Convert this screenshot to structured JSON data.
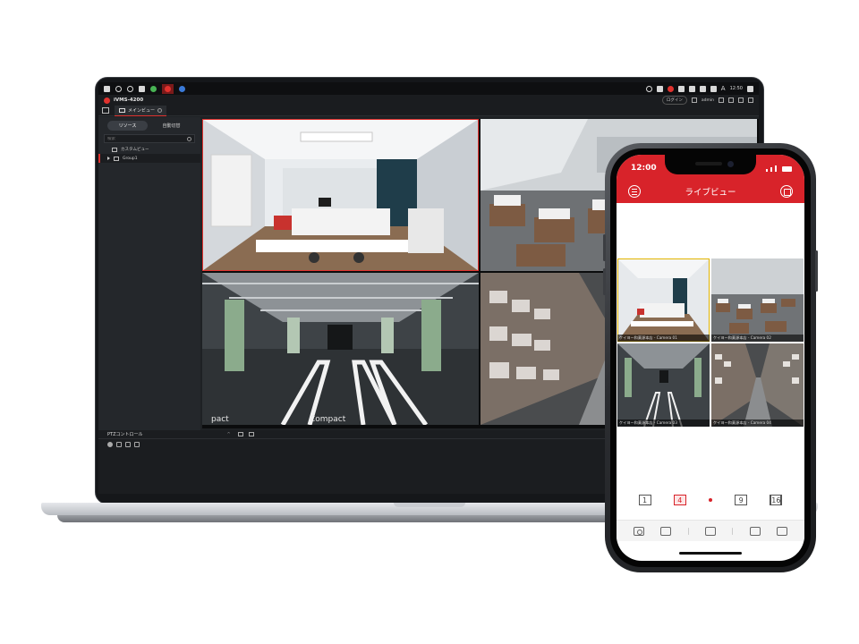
{
  "desktop": {
    "taskbar": {
      "clock": "12:50",
      "input_mode": "A"
    },
    "window": {
      "app_title": "iVMS-4200",
      "login_label": "ログイン",
      "user": "admin",
      "main_tab_label": "メインビュー"
    },
    "sidebar": {
      "segments": [
        "リソース",
        "自動切替"
      ],
      "search_placeholder": "検索",
      "tree": [
        "カスタムビュー",
        "Group1"
      ]
    },
    "ptz": {
      "title": "PTZコントロール"
    }
  },
  "phone": {
    "status_time": "12:00",
    "appbar_title": "ライブビュー",
    "cameras": [
      "ケイヨー和菓源本店 - Camera 01",
      "ケイヨー和菓源本店 - Camera 02",
      "ケイヨー和菓源本店 - Camera 03",
      "ケイヨー和菓源本店 - Camera 04"
    ],
    "layouts": [
      "1",
      "4",
      "9",
      "16"
    ],
    "accent": "#d8232a"
  },
  "colors": {
    "selected_border": "#e0322e",
    "phone_selected_border": "#e2b400"
  }
}
